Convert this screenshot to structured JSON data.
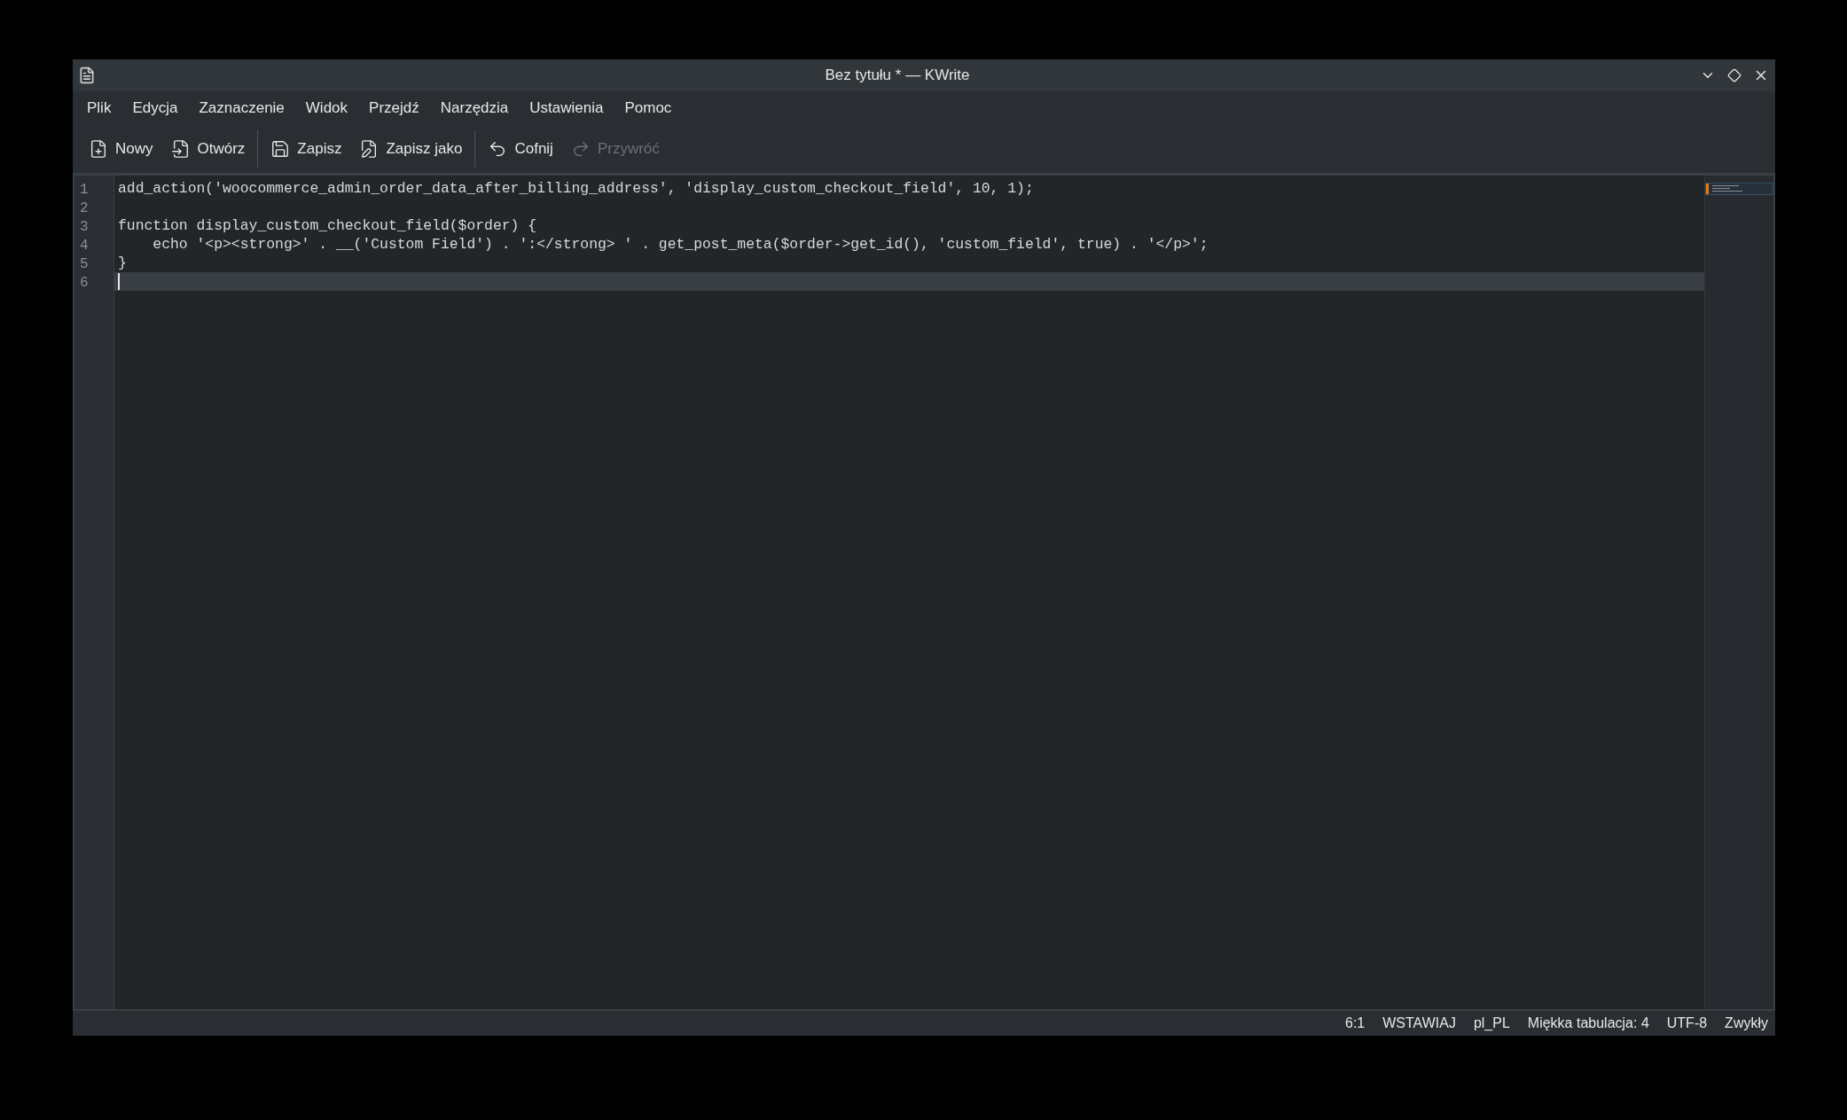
{
  "window": {
    "title": "Bez tytułu * — KWrite"
  },
  "menu": [
    "Plik",
    "Edycja",
    "Zaznaczenie",
    "Widok",
    "Przejdź",
    "Narzędzia",
    "Ustawienia",
    "Pomoc"
  ],
  "toolbar": [
    {
      "kind": "new",
      "label": "Nowy",
      "disabled": false
    },
    {
      "kind": "open",
      "label": "Otwórz",
      "disabled": false
    },
    {
      "kind": "separator"
    },
    {
      "kind": "save",
      "label": "Zapisz",
      "disabled": false
    },
    {
      "kind": "saveas",
      "label": "Zapisz jako",
      "disabled": false
    },
    {
      "kind": "separator"
    },
    {
      "kind": "undo",
      "label": "Cofnij",
      "disabled": false
    },
    {
      "kind": "redo",
      "label": "Przywróć",
      "disabled": true
    }
  ],
  "editor": {
    "lines": [
      {
        "number": "1",
        "text": "add_action('woocommerce_admin_order_data_after_billing_address', 'display_custom_checkout_field', 10, 1);",
        "selected": false
      },
      {
        "number": "2",
        "selected": false
      },
      {
        "number": "3",
        "text": "function display_custom_checkout_field($order) {",
        "selected": false
      },
      {
        "number": "4",
        "text": "    echo '<p><strong>' . __('Custom Field') . ':</strong> ' . get_post_meta($order->get_id(), 'custom_field', true) . '</p>';",
        "selected": false
      },
      {
        "number": "5",
        "text": "}",
        "selected": false
      },
      {
        "number": "6",
        "selected": true
      }
    ]
  },
  "status_bar": [
    "6:1",
    "WSTAWIAJ",
    "pl_PL",
    "Miękka tabulacja: 4",
    "UTF-8",
    "Zwykły"
  ]
}
